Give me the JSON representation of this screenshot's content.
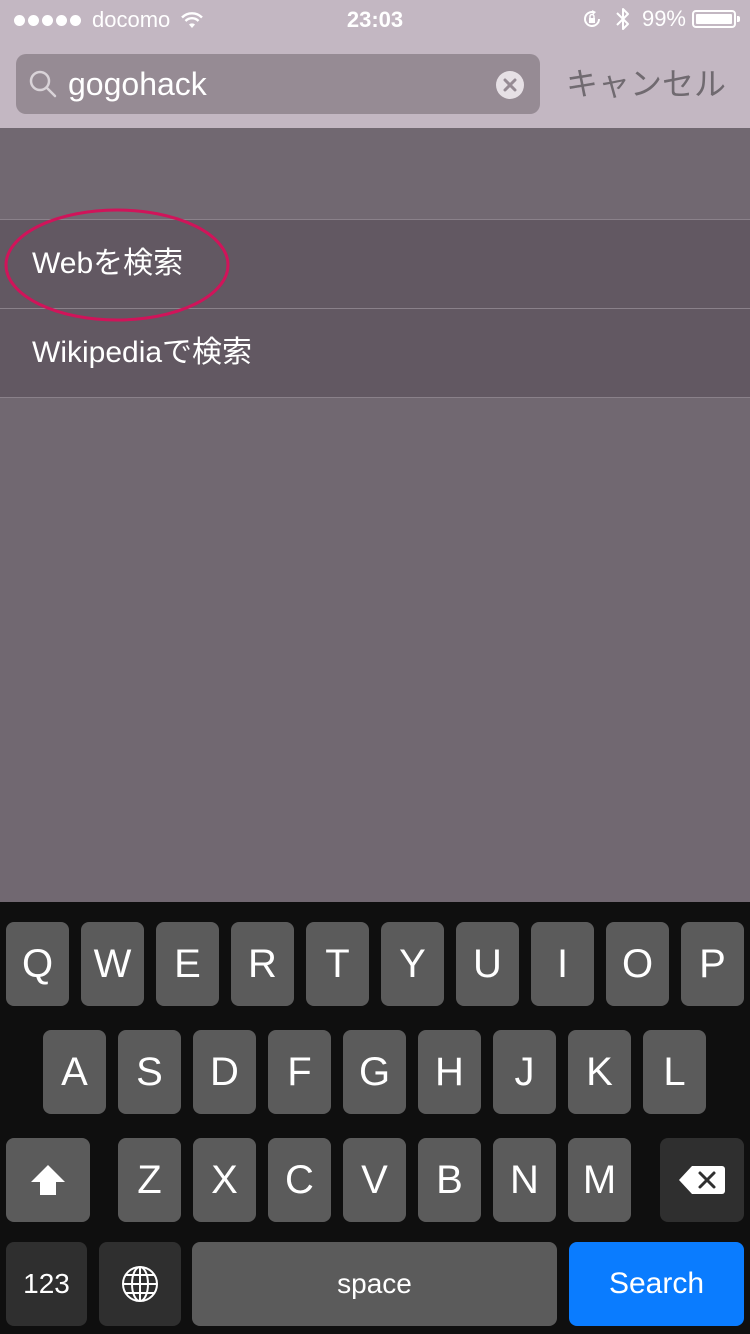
{
  "status_bar": {
    "carrier": "docomo",
    "time": "23:03",
    "battery": "99%",
    "battery_level": 0.99
  },
  "search": {
    "query": "gogohack",
    "cancel_label": "キャンセル"
  },
  "results": [
    {
      "label": "Webを検索"
    },
    {
      "label": "Wikipediaで検索"
    }
  ],
  "keyboard": {
    "row1": [
      "Q",
      "W",
      "E",
      "R",
      "T",
      "Y",
      "U",
      "I",
      "O",
      "P"
    ],
    "row2": [
      "A",
      "S",
      "D",
      "F",
      "G",
      "H",
      "J",
      "K",
      "L"
    ],
    "row3": [
      "Z",
      "X",
      "C",
      "V",
      "B",
      "N",
      "M"
    ],
    "numbers_label": "123",
    "space_label": "space",
    "search_label": "Search"
  },
  "colors": {
    "accent": "#0a7cff",
    "annotation": "#d0145a"
  }
}
